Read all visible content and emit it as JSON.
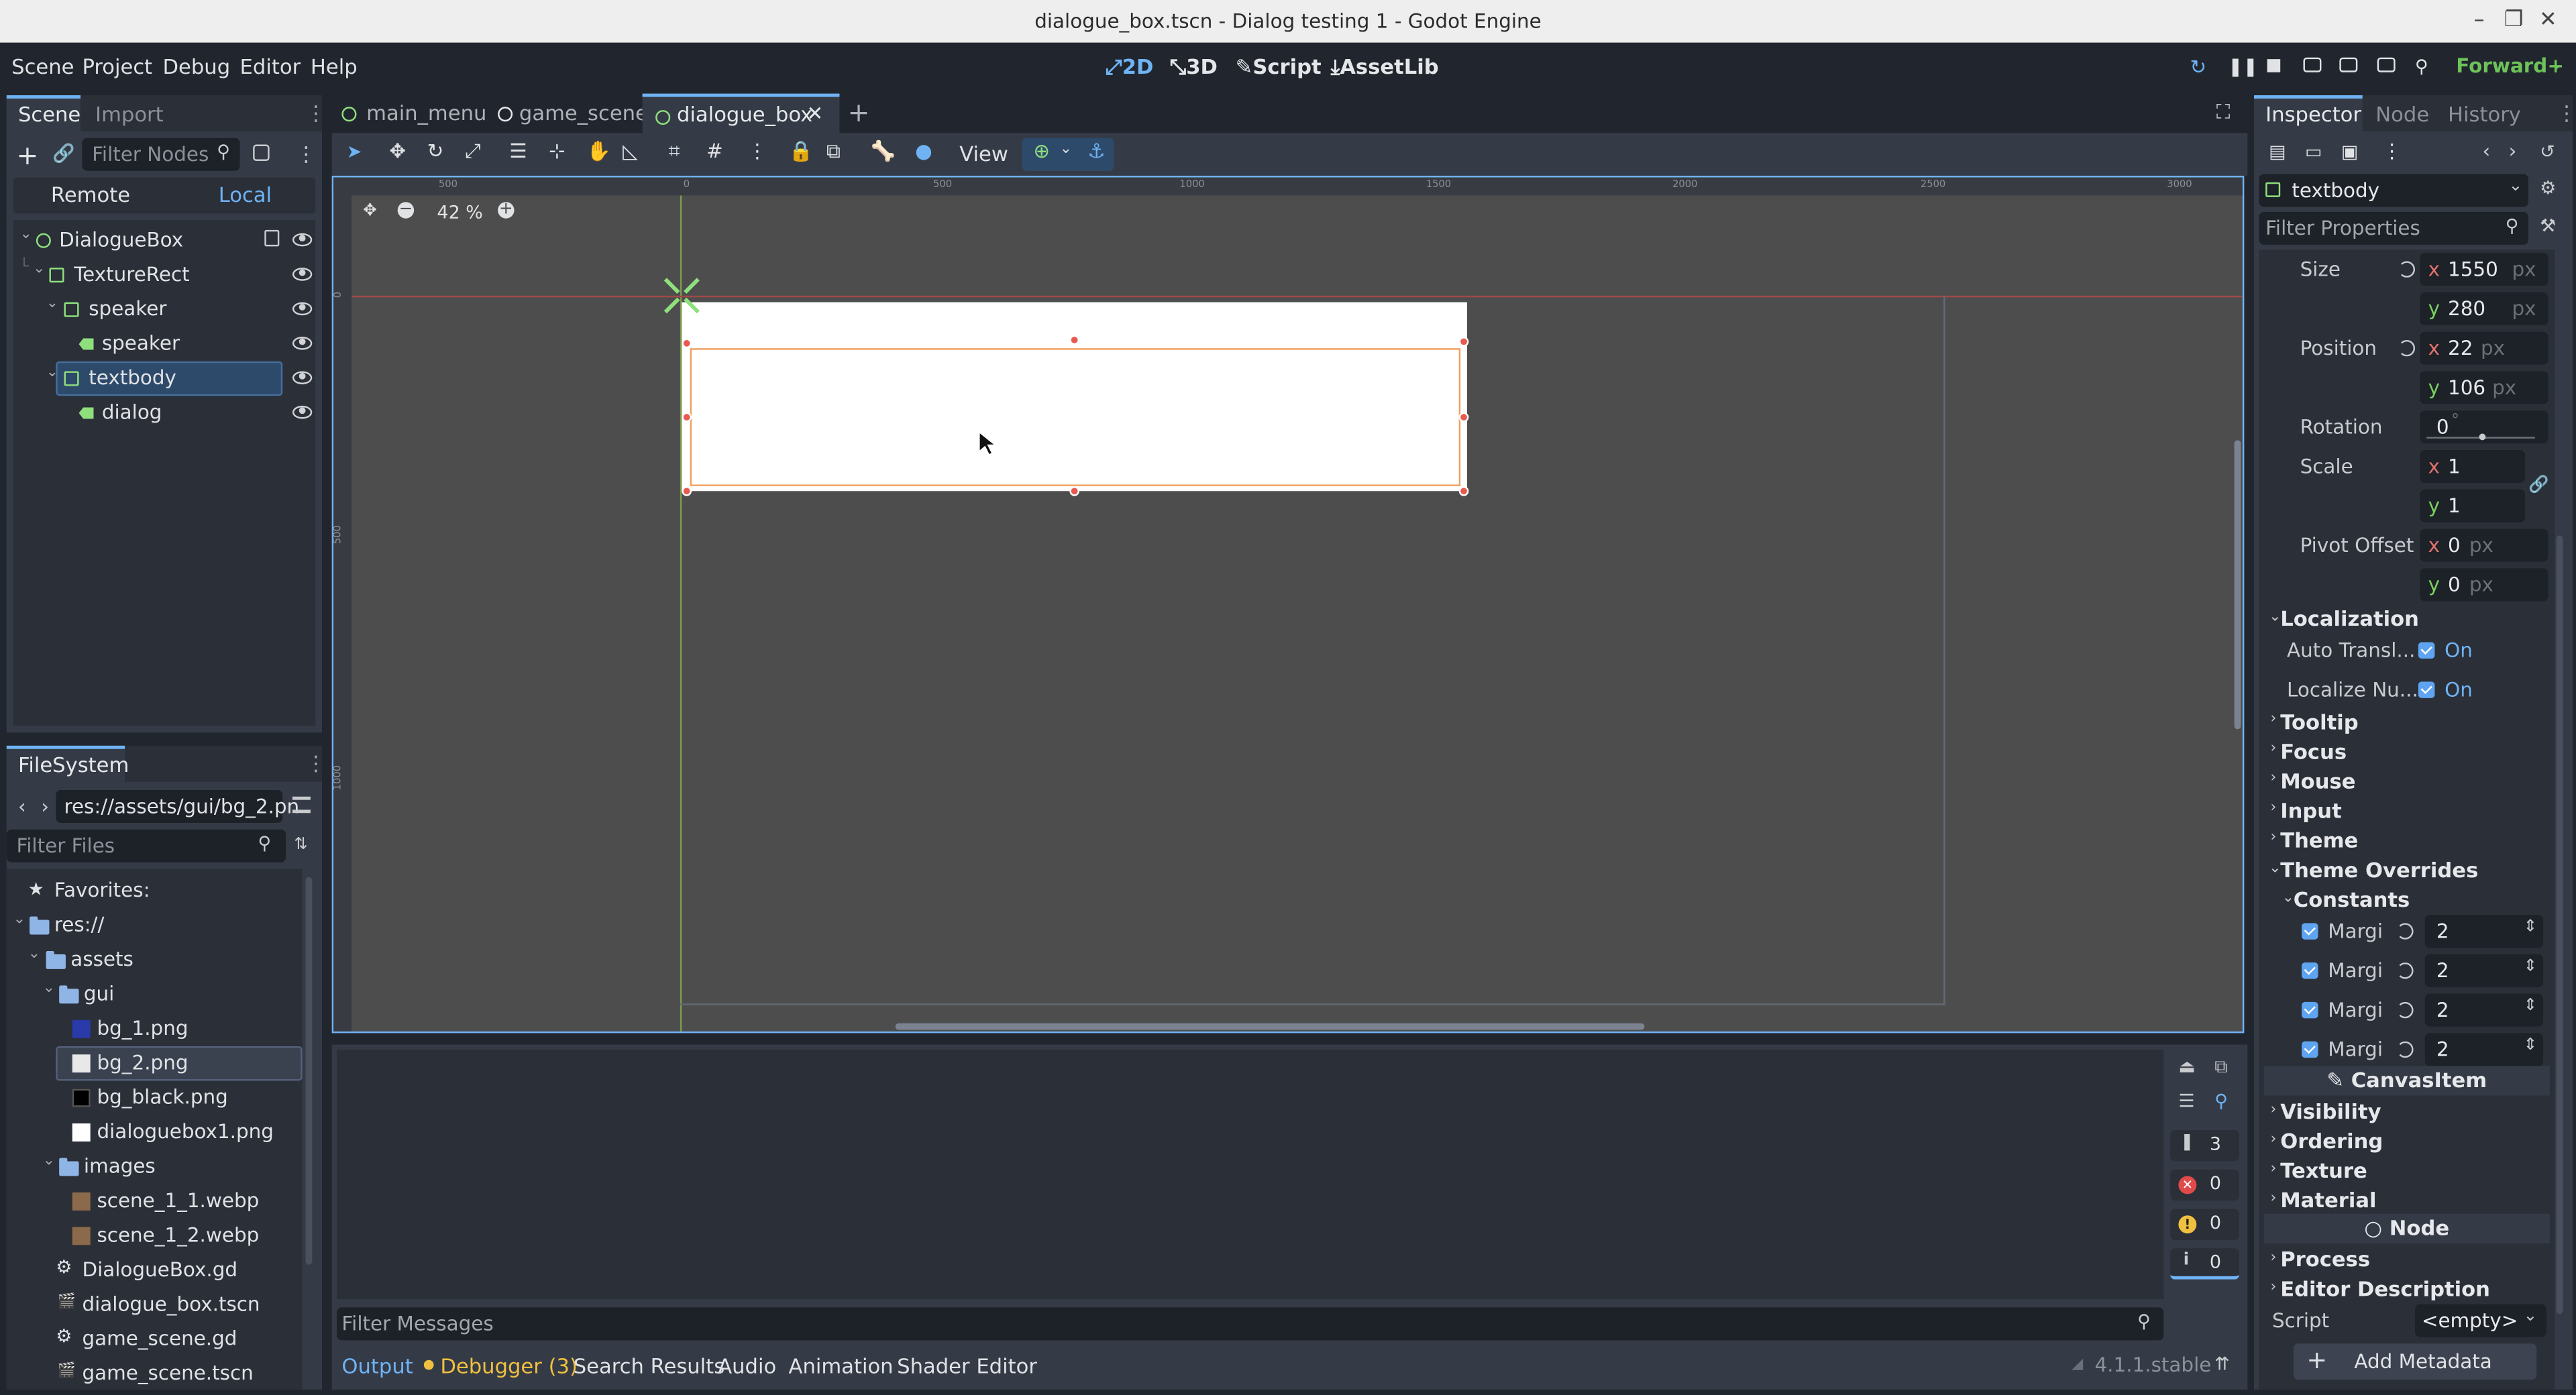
{
  "window": {
    "title": "dialogue_box.tscn - Dialog testing 1 - Godot Engine"
  },
  "menu": {
    "scene": "Scene",
    "project": "Project",
    "debug": "Debug",
    "editor": "Editor",
    "help": "Help"
  },
  "modes": {
    "m2d": "2D",
    "m3d": "3D",
    "script": "Script",
    "assetlib": "AssetLib"
  },
  "renderer": "Forward+",
  "scene_dock": {
    "tab_scene": "Scene",
    "tab_import": "Import",
    "filter_placeholder": "Filter Nodes",
    "remote": "Remote",
    "local": "Local",
    "nodes": [
      "DialogueBox",
      "TextureRect",
      "speaker",
      "speaker",
      "textbody",
      "dialog"
    ]
  },
  "filesystem": {
    "title": "FileSystem",
    "path": "res://assets/gui/bg_2.pn",
    "filter_placeholder": "Filter Files",
    "favorites": "Favorites:",
    "items": [
      "res://",
      "assets",
      "gui",
      "bg_1.png",
      "bg_2.png",
      "bg_black.png",
      "dialoguebox1.png",
      "images",
      "scene_1_1.webp",
      "scene_1_2.webp",
      "DialogueBox.gd",
      "dialogue_box.tscn",
      "game_scene.gd",
      "game_scene.tscn"
    ]
  },
  "editor_tabs": [
    "main_menu",
    "game_scene",
    "dialogue_box"
  ],
  "toolbar": {
    "view": "View"
  },
  "viewport": {
    "zoom": "42 %",
    "ruler_ticks": [
      "500",
      "0",
      "500",
      "1000",
      "1500",
      "2000",
      "2500",
      "3000"
    ],
    "ruler_v": [
      "0",
      "500",
      "1000"
    ]
  },
  "bottom": {
    "filter_messages": "Filter Messages",
    "tabs": [
      "Output",
      "Debugger (3)",
      "Search Results",
      "Audio",
      "Animation",
      "Shader Editor"
    ],
    "counts": [
      "3",
      "0",
      "0",
      "0"
    ],
    "version": "4.1.1.stable"
  },
  "inspector": {
    "tabs": [
      "Inspector",
      "Node",
      "History"
    ],
    "node_name": "textbody",
    "filter_placeholder": "Filter Properties",
    "size_label": "Size",
    "size_x": "1550",
    "size_y": "280",
    "position_label": "Position",
    "pos_x": "22",
    "pos_y": "106",
    "rotation_label": "Rotation",
    "rotation": "0",
    "rotation_unit": "°",
    "scale_label": "Scale",
    "scale_x": "1",
    "scale_y": "1",
    "pivot_label": "Pivot Offset",
    "pivot_x": "0",
    "pivot_y": "0",
    "unit_px": "px",
    "localization": "Localization",
    "auto_translate": "Auto Transl...",
    "auto_translate_val": "On",
    "localize_num": "Localize Nu...",
    "localize_num_val": "On",
    "sections": [
      "Tooltip",
      "Focus",
      "Mouse",
      "Input",
      "Theme",
      "Theme Overrides"
    ],
    "constants": "Constants",
    "margins": [
      {
        "label": "Margi",
        "value": "2"
      },
      {
        "label": "Margi",
        "value": "2"
      },
      {
        "label": "Margi",
        "value": "2"
      },
      {
        "label": "Margi",
        "value": "2"
      }
    ],
    "canvas_item": "CanvasItem",
    "canvas_sections": [
      "Visibility",
      "Ordering",
      "Texture",
      "Material"
    ],
    "node_header": "Node",
    "node_sections": [
      "Process",
      "Editor Description"
    ],
    "script_label": "Script",
    "script_value": "<empty>",
    "add_metadata": "Add Metadata"
  }
}
